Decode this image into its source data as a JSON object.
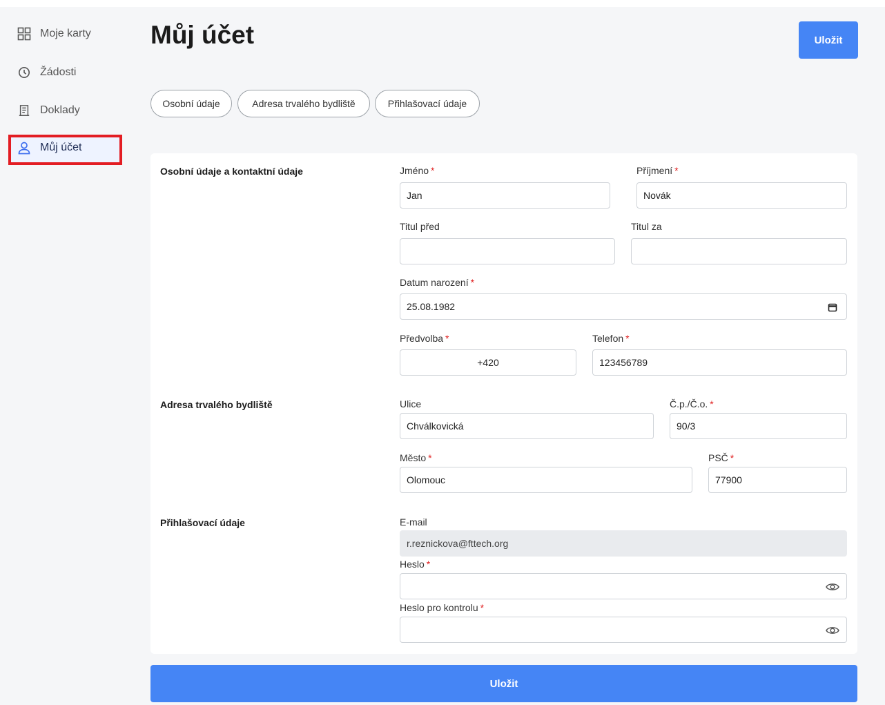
{
  "colors": {
    "primary": "#4585f5",
    "highlight_border": "#e31d23",
    "required": "#e02020"
  },
  "sidebar": {
    "items": [
      {
        "label": "Moje karty",
        "icon": "grid-icon"
      },
      {
        "label": "Žádosti",
        "icon": "clock-icon"
      },
      {
        "label": "Doklady",
        "icon": "receipt-icon"
      },
      {
        "label": "Můj účet",
        "icon": "user-icon",
        "active": true
      }
    ]
  },
  "header": {
    "title": "Můj účet",
    "save_label": "Uložit"
  },
  "tabs": [
    {
      "label": "Osobní údaje"
    },
    {
      "label": "Adresa trvalého bydliště"
    },
    {
      "label": "Přihlašovací údaje"
    }
  ],
  "personal": {
    "section_title": "Osobní údaje a kontaktní údaje",
    "first_name": {
      "label": "Jméno",
      "value": "Jan"
    },
    "last_name": {
      "label": "Příjmení",
      "value": "Novák"
    },
    "title_before": {
      "label": "Titul před",
      "value": ""
    },
    "title_after": {
      "label": "Titul za",
      "value": ""
    },
    "birth_date": {
      "label": "Datum narození",
      "value": "25.08.1982"
    },
    "prefix": {
      "label": "Předvolba",
      "value": "+420"
    },
    "phone": {
      "label": "Telefon",
      "value": "123456789"
    }
  },
  "address": {
    "section_title": "Adresa trvalého bydliště",
    "street": {
      "label": "Ulice",
      "value": "Chválkovická"
    },
    "house_number": {
      "label": "Č.p./Č.o.",
      "value": "90/3"
    },
    "city": {
      "label": "Město",
      "value": "Olomouc"
    },
    "zip": {
      "label": "PSČ",
      "value": "77900"
    }
  },
  "login": {
    "section_title": "Přihlašovací údaje",
    "email": {
      "label": "E-mail",
      "value": "r.reznickova@fttech.org"
    },
    "password": {
      "label": "Heslo",
      "value": ""
    },
    "password_confirm": {
      "label": "Heslo pro kontrolu",
      "value": ""
    }
  },
  "footer": {
    "save_label": "Uložit"
  }
}
